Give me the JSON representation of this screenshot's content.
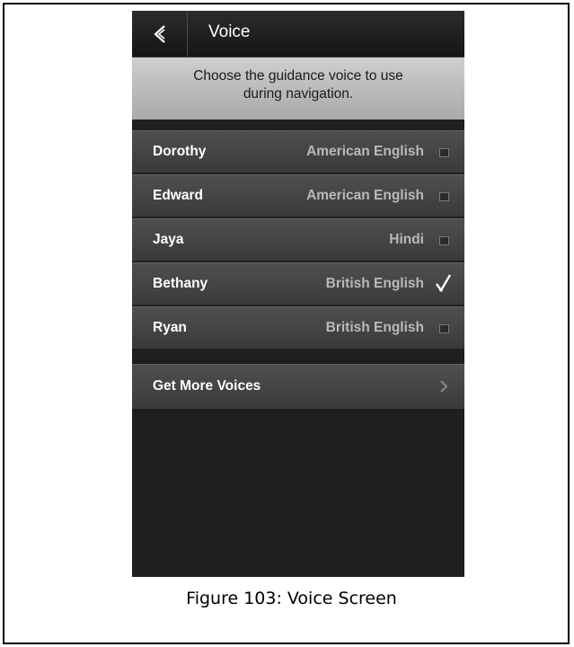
{
  "header": {
    "title": "Voice",
    "back_icon": "back-arrow-icon"
  },
  "description": {
    "line1": "Choose the guidance voice to use",
    "line2": "during navigation."
  },
  "voices": [
    {
      "name": "Dorothy",
      "language": "American English",
      "selected": false
    },
    {
      "name": "Edward",
      "language": "American English",
      "selected": false
    },
    {
      "name": "Jaya",
      "language": "Hindi",
      "selected": false
    },
    {
      "name": "Bethany",
      "language": "British English",
      "selected": true
    },
    {
      "name": "Ryan",
      "language": "British English",
      "selected": false
    }
  ],
  "more": {
    "label": "Get More Voices",
    "icon": "chevron-right-icon"
  },
  "caption": "Figure 103: Voice Screen",
  "colors": {
    "screen_background": "#1f1f1f",
    "description_background": "#bdbdbd",
    "row_background": "#444444",
    "language_text": "#b9b9b9"
  }
}
